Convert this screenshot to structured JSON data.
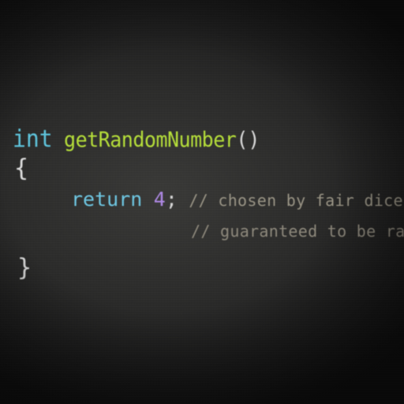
{
  "editor": {
    "colors": {
      "background": "#2c2c2b",
      "type_keyword": "#5fc6de",
      "function_name": "#b7e03a",
      "return_keyword": "#6fc8e4",
      "number_literal": "#b08ae6",
      "punctuation": "#dcdcdc",
      "comment": "#9a9586"
    },
    "lines": [
      {
        "type_keyword": "int",
        "function_name": "getRandomNumber",
        "parens": "()"
      },
      {
        "open_brace": "{"
      },
      {
        "return_keyword": "return",
        "value": "4",
        "semicolon": ";",
        "comment": "// chosen by fair dice rol"
      },
      {
        "comment": "// guaranteed to be randon"
      },
      {
        "close_brace": "}"
      }
    ]
  }
}
